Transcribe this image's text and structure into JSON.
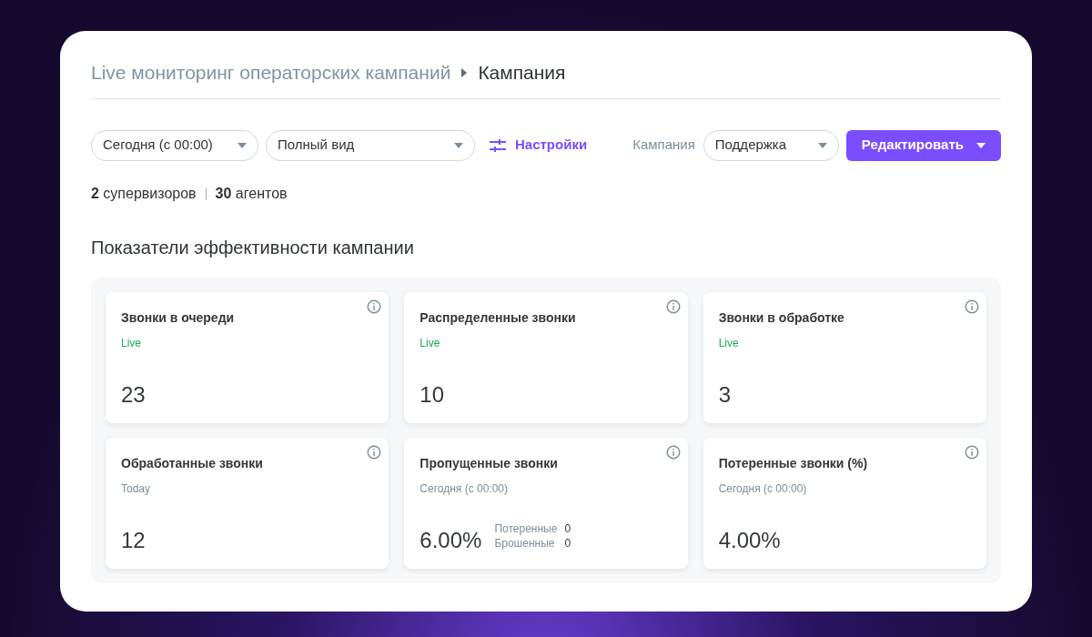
{
  "breadcrumb": {
    "parent": "Live мониторинг операторских кампаний",
    "current": "Кампания"
  },
  "filters": {
    "period": "Сегодня (с 00:00)",
    "view": "Полный вид",
    "settings": "Настройки",
    "campaign_label": "Кампания",
    "campaign": "Поддержка",
    "edit_button": "Редактировать"
  },
  "summary": {
    "supervisors_count": "2",
    "supervisors_label": "супервизоров",
    "agents_count": "30",
    "agents_label": "агентов"
  },
  "section_title": "Показатели эффективности кампании",
  "metrics": [
    {
      "title": "Звонки в очереди",
      "subtitle": "Live",
      "kind": "live",
      "value": "23"
    },
    {
      "title": "Распределенные звонки",
      "subtitle": "Live",
      "kind": "live",
      "value": "10"
    },
    {
      "title": "Звонки в обработке",
      "subtitle": "Live",
      "kind": "live",
      "value": "3"
    },
    {
      "title": "Обработанные звонки",
      "subtitle": "Today",
      "kind": "period",
      "value": "12"
    },
    {
      "title": "Пропущенные звонки",
      "subtitle": "Сегодня (с 00:00)",
      "kind": "period",
      "value": "6.00%",
      "details": [
        {
          "label": "Потеренные",
          "value": "0"
        },
        {
          "label": "Брошенные",
          "value": "0"
        }
      ]
    },
    {
      "title": "Потеренные звонки (%)",
      "subtitle": "Сегодня (с 00:00)",
      "kind": "period",
      "value": "4.00%"
    }
  ]
}
